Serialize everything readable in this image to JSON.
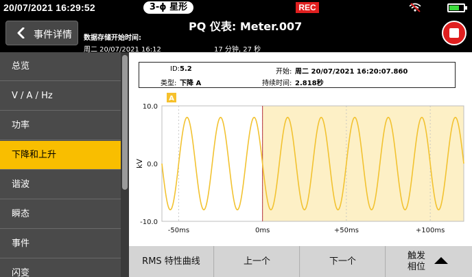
{
  "status_bar": {
    "datetime": "20/07/2021  16:29:52",
    "mode": "3-ϕ 星形",
    "rec": "REC",
    "battery_fraction": 0.7
  },
  "header": {
    "back_label": "事件详情",
    "title": "PQ 仪表: Meter.007",
    "storage_label": "数据存储开始时间:",
    "storage_start": "周二 20/07/2021 16:12",
    "storage_duration": "17 分钟, 27 秒"
  },
  "sidebar": {
    "items": [
      {
        "label": "总览",
        "active": false
      },
      {
        "label": "V / A / Hz",
        "active": false
      },
      {
        "label": "功率",
        "active": false
      },
      {
        "label": "下降和上升",
        "active": true
      },
      {
        "label": "谐波",
        "active": false
      },
      {
        "label": "瞬态",
        "active": false
      },
      {
        "label": "事件",
        "active": false
      },
      {
        "label": "闪变",
        "active": false
      }
    ]
  },
  "event_info": {
    "id_label": "ID:",
    "id_value": "5.2",
    "start_label": "开始:",
    "start_value": "周二 20/07/2021 16:20:07.860",
    "type_label": "类型:",
    "type_value": "下降 A",
    "duration_label": "持续时间:",
    "duration_value": "2.818秒"
  },
  "chart_data": {
    "type": "line",
    "ylabel": "kV",
    "ylim": [
      -10.0,
      10.0
    ],
    "ytick_labels": [
      "10.0",
      "0.0",
      "-10.0"
    ],
    "ytick_values": [
      10.0,
      0.0,
      -10.0
    ],
    "xlim": [
      -60,
      120
    ],
    "xtick_labels": [
      "-50ms",
      "0ms",
      "+50ms",
      "+100ms"
    ],
    "xtick_values": [
      -50,
      0,
      50,
      100
    ],
    "phase_badge": "A",
    "trigger_ms": 0,
    "series": [
      {
        "color": "#f2c230",
        "frequency_hz": 50,
        "amplitude_kv": 8.0,
        "phase_deg": 180
      }
    ],
    "colors": {
      "line": "#f2c230",
      "shade": "#fdf0c6",
      "trigger_line": "#b5303a",
      "grid": "#bdbdbd"
    }
  },
  "bottom_buttons": {
    "rms_label": "RMS 特性曲线",
    "prev_label": "上一个",
    "next_label": "下一个",
    "trigger_label_1": "触发",
    "trigger_label_2": "相位"
  }
}
